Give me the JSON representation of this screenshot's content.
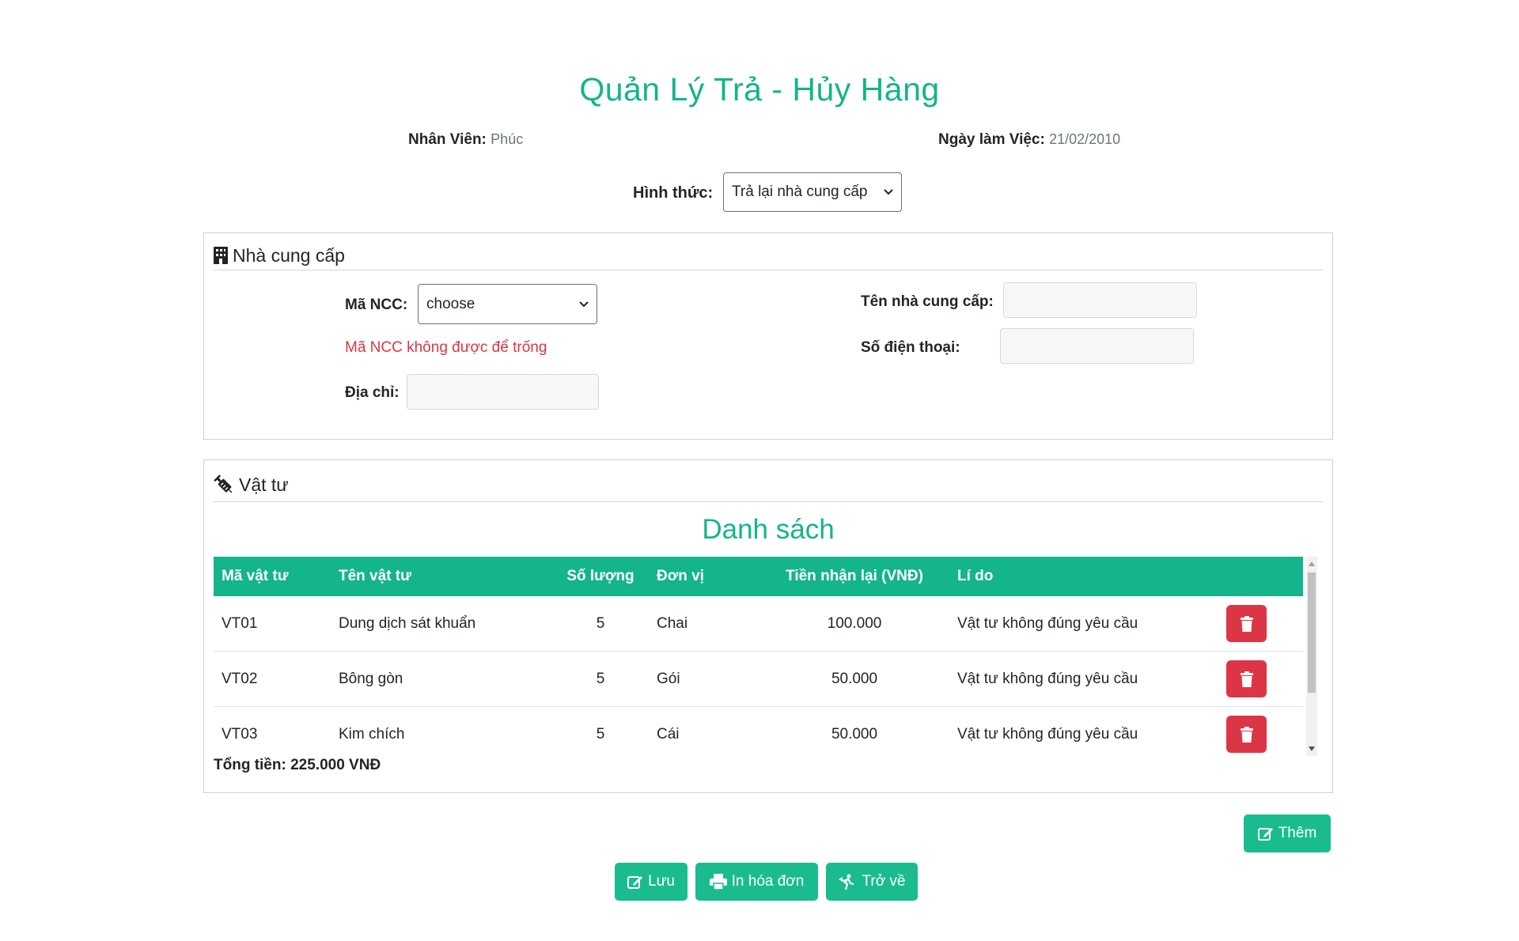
{
  "header": {
    "title": "Quản Lý Trả - Hủy Hàng"
  },
  "info": {
    "employee_label": "Nhân Viên:",
    "employee_value": "Phúc",
    "date_label": "Ngày làm Việc:",
    "date_value": "21/02/2010"
  },
  "form": {
    "type_label": "Hình thức:",
    "type_selected": "Trả lại nhà cung cấp"
  },
  "supplier": {
    "legend": "Nhà cung cấp",
    "code_label": "Mã NCC:",
    "code_selected": "choose",
    "code_error": "Mã NCC không được để trống",
    "address_label": "Địa chỉ:",
    "address_value": "",
    "name_label": "Tên nhà cung cấp:",
    "name_value": "",
    "phone_label": "Số điện thoại:",
    "phone_value": ""
  },
  "materials": {
    "legend": "Vật tư",
    "list_title": "Danh sách",
    "columns": [
      "Mã vật tư",
      "Tên vật tư",
      "Số lượng",
      "Đơn vị",
      "Tiền nhận lại (VNĐ)",
      "Lí do"
    ],
    "rows": [
      {
        "code": "VT01",
        "name": "Dung dịch sát khuẩn",
        "qty": "5",
        "unit": "Chai",
        "refund": "100.000",
        "reason": "Vật tư không đúng yêu cầu"
      },
      {
        "code": "VT02",
        "name": "Bông gòn",
        "qty": "5",
        "unit": "Gói",
        "refund": "50.000",
        "reason": "Vật tư không đúng yêu cầu"
      },
      {
        "code": "VT03",
        "name": "Kim chích",
        "qty": "5",
        "unit": "Cái",
        "refund": "50.000",
        "reason": "Vật tư không đúng yêu cầu"
      }
    ],
    "total": "Tổng tiền: 225.000 VNĐ"
  },
  "actions": {
    "add_label": "Thêm",
    "save_label": "Lưu",
    "print_label": "In hóa đơn",
    "back_label": "Trở về"
  },
  "icons": {
    "building": "building-icon",
    "syringe": "syringe-icon",
    "trash": "trash-icon",
    "edit": "edit-icon",
    "print": "print-icon",
    "back": "walking-back-icon"
  },
  "colors": {
    "accent": "#14b48c",
    "button": "#1abc8f",
    "danger": "#dc3545",
    "error_text": "#dc3545"
  }
}
